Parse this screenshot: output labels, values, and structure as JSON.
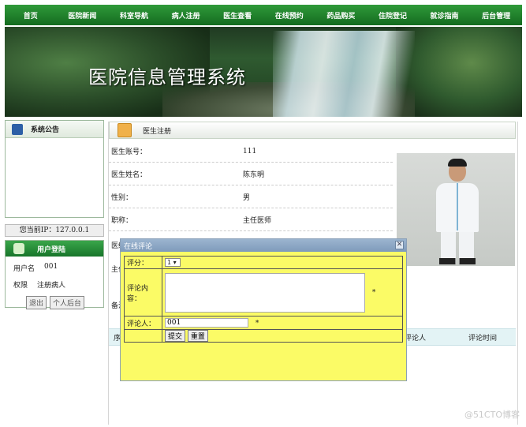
{
  "nav": {
    "items": [
      "首页",
      "医院新闻",
      "科室导航",
      "病人注册",
      "医生查看",
      "在线预约",
      "药品购买",
      "住院登记",
      "就诊指南",
      "后台管理"
    ]
  },
  "banner": {
    "title": "医院信息管理系统"
  },
  "notice": {
    "title": "系统公告"
  },
  "ip": {
    "text": "您当前IP：127.0.0.1"
  },
  "login": {
    "title": "用户登陆",
    "user_label": "用户名",
    "user_value": "001",
    "role_label": "权限",
    "role_value": "注册病人",
    "logout": "退出",
    "personal": "个人后台"
  },
  "main": {
    "title": "医生注册",
    "rows": [
      {
        "label": "医生账号：",
        "value": "111"
      },
      {
        "label": "医生姓名：",
        "value": "陈东明"
      },
      {
        "label": "性别：",
        "value": "男"
      },
      {
        "label": "职称：",
        "value": "主任医师"
      }
    ],
    "partial_labels": [
      "医结",
      "主任",
      "备注"
    ],
    "comments": {
      "col_index": "序号",
      "col_author": "评论人",
      "col_time": "评论时间"
    }
  },
  "dialog": {
    "title": "在线评论",
    "close": "✕",
    "score_label": "评分：",
    "score_value": "1",
    "content_label": "评论内容：",
    "author_label": "评论人：",
    "author_value": "001",
    "required_mark": "*",
    "submit": "提交",
    "reset": "重置"
  },
  "watermark": "@51CTO博客"
}
